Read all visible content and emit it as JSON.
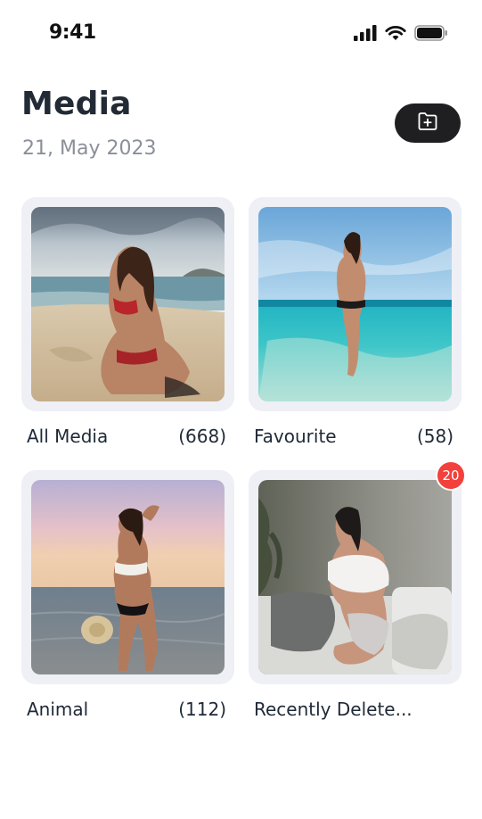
{
  "status_bar": {
    "time": "9:41",
    "icons": [
      "signal-icon",
      "wifi-icon",
      "battery-icon"
    ]
  },
  "header": {
    "title": "Media",
    "date": "21, May 2023",
    "new_folder_icon": "folder-plus-icon"
  },
  "albums": [
    {
      "name": "All Media",
      "count": "(668)"
    },
    {
      "name": "Favourite",
      "count": "(58)"
    },
    {
      "name": "Animal",
      "count": "(112)"
    },
    {
      "name": "Recently Delete...",
      "count": "",
      "badge": "20"
    }
  ],
  "colors": {
    "text": "#1f2937",
    "subtext": "#8b8f98",
    "card": "#eef0f5",
    "button": "#1f1f21",
    "badge": "#f2403c"
  }
}
